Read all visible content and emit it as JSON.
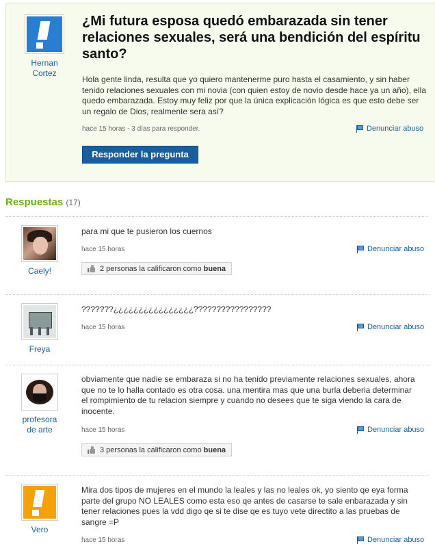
{
  "question": {
    "author": "Hernan Cortez",
    "title": "¿Mi futura esposa quedó embarazada sin tener relaciones sexuales, será una bendición del espíritu santo?",
    "body": "Hola gente linda, resulta que yo quiero mantenerme puro hasta el casamiento, y sin haber tenido relaciones sexuales con mi novia (con quien estoy de novio desde hace ya un año), ella quedo embarazada. Estoy muy feliz por que la única explicación lógica es que esto debe ser un regalo de Dios, realmente sera así?",
    "meta": "hace 15 horas - 3 días para responder.",
    "report_label": "Denunciar abuso",
    "answer_button": "Responder la pregunta"
  },
  "answers_header": {
    "label": "Respuestas",
    "count": "(17)"
  },
  "answers": [
    {
      "author": "Caely!",
      "text": "para mi que te pusieron los cuernos",
      "time": "hace 15 horas",
      "report_label": "Denunciar abuso",
      "rating_prefix": "2 personas la calificaron como",
      "rating_word": "buena"
    },
    {
      "author": "Freya",
      "text": "???????¿¿¿¿¿¿¿¿¿¿¿¿¿¿¿¿?????????????????",
      "time": "hace 15 horas",
      "report_label": "Denunciar abuso"
    },
    {
      "author": "profesora de arte",
      "text": "obviamente que nadie se embaraza si no ha tenido previamente relaciones sexuales, ahora que no te lo halla contado es otra cosa. una mentira mas que una burla deberia determinar el rompimiento de tu relacion siempre y cuando no desees que te siga viendo la cara de inocente.",
      "time": "hace 15 horas",
      "report_label": "Denunciar abuso",
      "rating_prefix": "3 personas la calificaron como",
      "rating_word": "buena"
    },
    {
      "author": "Vero",
      "text": "Mira dos tipos de mujeres en el mundo la leales y las no leales ok, yo siento qe eya forma parte del grupo NO LEALES como esta eso qe antes de casarse te sale enbarazada y sin tener relaciones pues la vdd digo qe si te dise qe es tuyo vete directito a las pruebas de sangre =P",
      "time": "hace 15 horas",
      "report_label": "Denunciar abuso"
    }
  ],
  "colors": {
    "link": "#1a5f9c",
    "accent_green": "#6cae1e",
    "button": "#1a5f9c",
    "question_bg": "#f6fbee",
    "default_avatar_blue": "#2a7ed1",
    "default_avatar_orange": "#f4a10a"
  },
  "icons": [
    "flag-icon",
    "thumbs-up-icon",
    "default-avatar-icon"
  ]
}
